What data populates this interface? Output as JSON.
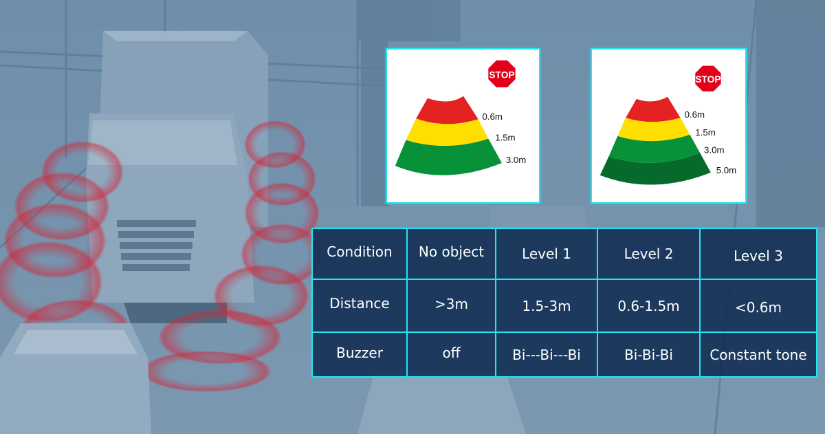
{
  "colors": {
    "background_tint": "#6b8aa6",
    "panel_border": "#22e6f2",
    "table_background": "#102c52",
    "table_border": "#1fe8f2",
    "zone_red": "#e52222",
    "zone_yellow": "#ffde00",
    "zone_green": "#07923a",
    "zone_dark_green": "#056a2c",
    "stop_red": "#e3001b",
    "sensor_wave_red": "#d0283a"
  },
  "background": {
    "description": "Blue-tinted illustration of a truck and cars with red parking-sensor waves"
  },
  "diagrams": [
    {
      "name": "three-zone-sensor",
      "stop_sign_text": "STOP",
      "zones": [
        {
          "color": "red",
          "label": "0.6m"
        },
        {
          "color": "yellow",
          "label": "1.5m"
        },
        {
          "color": "green",
          "label": "3.0m"
        }
      ]
    },
    {
      "name": "four-zone-sensor",
      "stop_sign_text": "STOP",
      "zones": [
        {
          "color": "red",
          "label": "0.6m"
        },
        {
          "color": "yellow",
          "label": "1.5m"
        },
        {
          "color": "green",
          "label": "3.0m"
        },
        {
          "color": "dark_green",
          "label": "5.0m"
        }
      ]
    }
  ],
  "table": {
    "rows": [
      {
        "header": "Condition",
        "cells": [
          "No object",
          "Level 1",
          "Level 2",
          "Level 3"
        ]
      },
      {
        "header": "Distance",
        "cells": [
          ">3m",
          "1.5-3m",
          "0.6-1.5m",
          "<0.6m"
        ]
      },
      {
        "header": "Buzzer",
        "cells": [
          "off",
          "Bi---Bi---Bi",
          "Bi-Bi-Bi",
          "Constant tone"
        ]
      }
    ]
  }
}
